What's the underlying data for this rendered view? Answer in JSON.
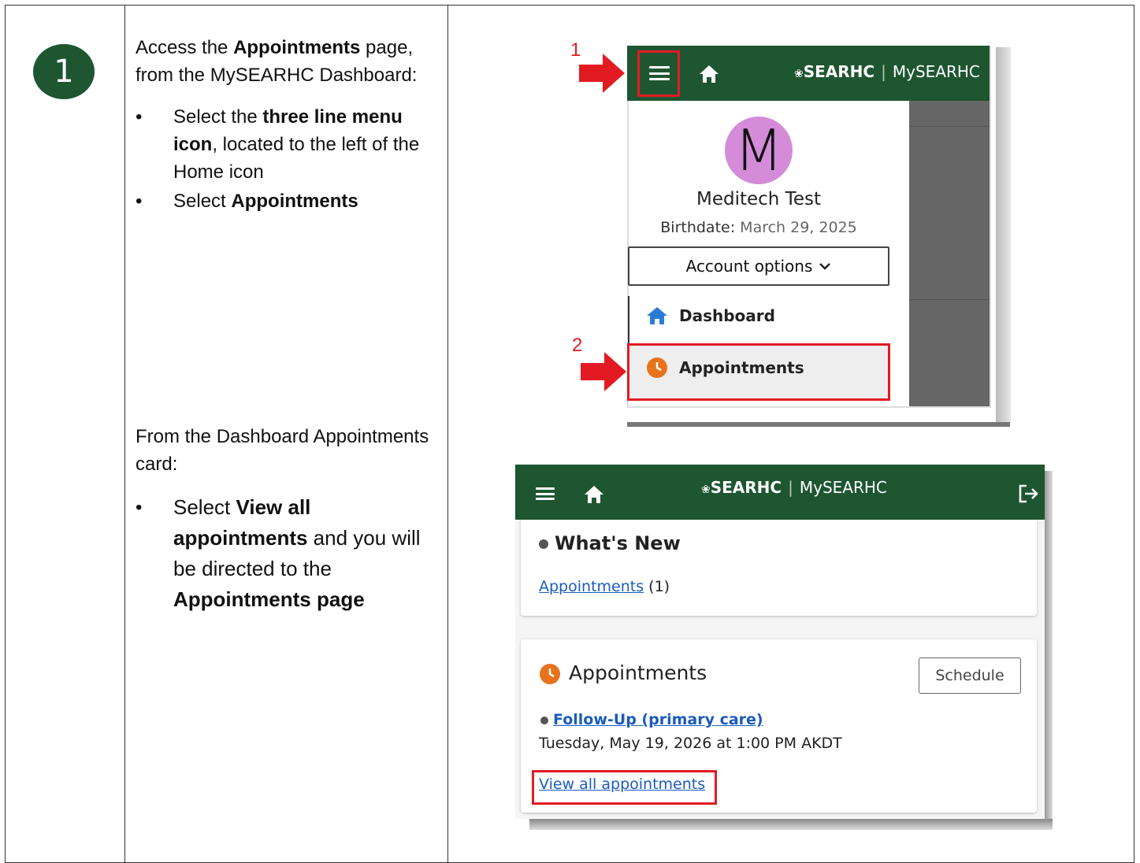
{
  "step": {
    "number": "1"
  },
  "instructions_top": {
    "p1_before": "Access the ",
    "p1_bold": "Appointments",
    "p1_after": " page, from the MySEARHC Dashboard:",
    "b1_before": "Select the ",
    "b1_bold": "three line menu icon",
    "b1_after": ", located to the left of the Home icon",
    "b2_before": "Select ",
    "b2_bold": "Appointments"
  },
  "instructions_bottom": {
    "p1": "From the Dashboard Appointments card:",
    "b1_before": "Select ",
    "b1_bold1": "View all appointments",
    "b1_mid": " and you will be directed to the ",
    "b1_bold2": "Appointments page"
  },
  "screenshot1": {
    "callout1": "1",
    "callout2": "2",
    "brand": "SEARHC",
    "brand_sep": "|",
    "portal": "MySEARHC",
    "avatar_letter": "M",
    "user_name": "Meditech Test",
    "birthdate_label": "Birthdate:",
    "birthdate_value": "March 29, 2025",
    "account_options": "Account options",
    "nav_dashboard": "Dashboard",
    "nav_appointments": "Appointments",
    "colors": {
      "header": "#1e5631",
      "callout": "#e21b23",
      "home_icon": "#2b7bd6",
      "clock_icon": "#e8731a"
    }
  },
  "screenshot2": {
    "brand": "SEARHC",
    "brand_sep": "|",
    "portal": "MySEARHC",
    "whats_new_title": "What's New",
    "whats_new_link": "Appointments",
    "whats_new_count": "(1)",
    "appointments_title": "Appointments",
    "schedule_button": "Schedule",
    "appt_link": "Follow-Up (primary care)",
    "appt_datetime": "Tuesday, May 19, 2026 at 1:00 PM AKDT",
    "view_all_link": "View all appointments"
  }
}
